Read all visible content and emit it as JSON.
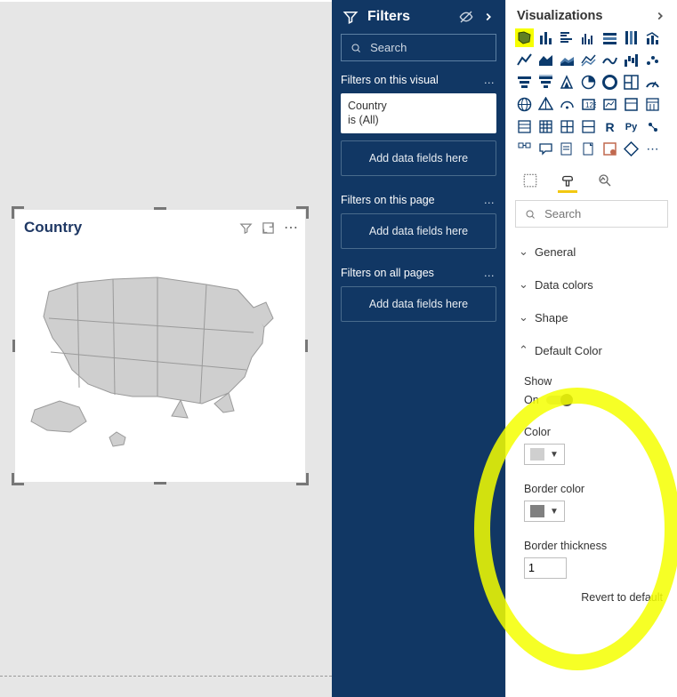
{
  "canvas": {
    "visual_title": "Country"
  },
  "filters": {
    "title": "Filters",
    "search_placeholder": "Search",
    "sections": {
      "visual": {
        "label": "Filters on this visual",
        "add_label": "Add data fields here"
      },
      "page": {
        "label": "Filters on this page",
        "add_label": "Add data fields here"
      },
      "all": {
        "label": "Filters on all pages",
        "add_label": "Add data fields here"
      }
    },
    "card": {
      "field": "Country",
      "condition": "is (All)"
    }
  },
  "viz": {
    "title": "Visualizations",
    "search_placeholder": "Search",
    "r_glyph": "R",
    "py_glyph": "Py",
    "more_glyph": "⋯",
    "format": {
      "groups": {
        "general": "General",
        "data_colors": "Data colors",
        "shape": "Shape",
        "default_color": "Default Color"
      },
      "default_color": {
        "show_label": "Show",
        "show_value": "On",
        "color_label": "Color",
        "color_hex": "#cfcfcf",
        "border_color_label": "Border color",
        "border_color_hex": "#808080",
        "border_thickness_label": "Border thickness",
        "border_thickness_value": "1"
      },
      "revert_label": "Revert to default"
    }
  }
}
